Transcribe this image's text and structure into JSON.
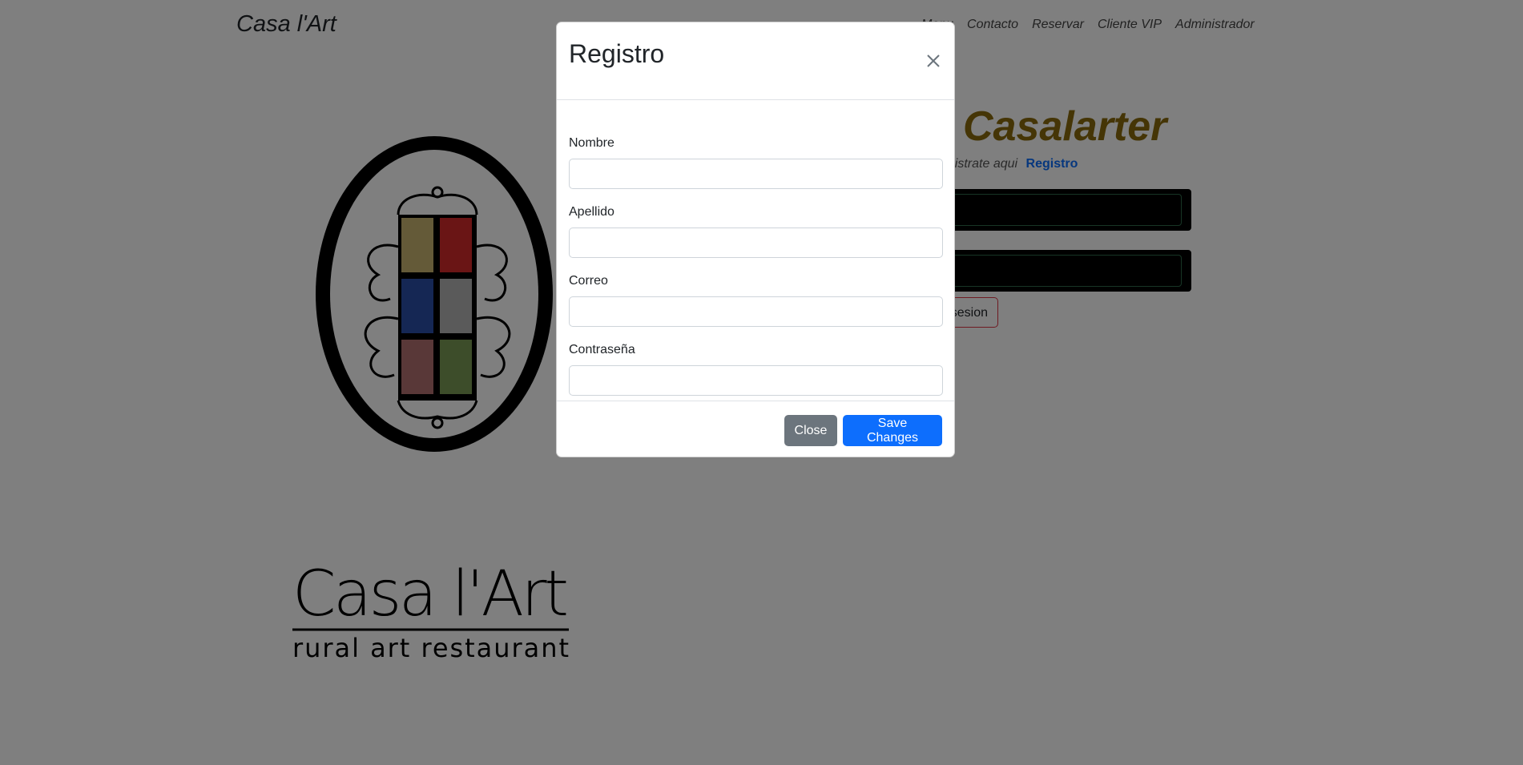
{
  "navbar": {
    "brand": "Casa l'Art",
    "links": [
      "Menu",
      "Contacto",
      "Reservar",
      "Cliente VIP",
      "Administrador"
    ]
  },
  "hero": {
    "title": "Casalarter",
    "subtitle_visible": "er registrate aqui",
    "register_link": "Registro",
    "login_button_visible": "sesion"
  },
  "wordmark": {
    "line1": "Casa l'Art",
    "line2": "rural art restaurant"
  },
  "modal": {
    "title": "Registro",
    "fields": [
      {
        "label": "Nombre",
        "value": ""
      },
      {
        "label": "Apellido",
        "value": ""
      },
      {
        "label": "Correo",
        "value": ""
      },
      {
        "label": "Contraseña",
        "value": ""
      }
    ],
    "close_button": "Close",
    "save_button": "Save Changes"
  },
  "colors": {
    "primary": "#0d6efd",
    "secondary": "#6c757d",
    "hero_title": "#8a6b0c",
    "danger_outline": "#dc3545",
    "backdrop": "rgba(0,0,0,0.5)"
  }
}
